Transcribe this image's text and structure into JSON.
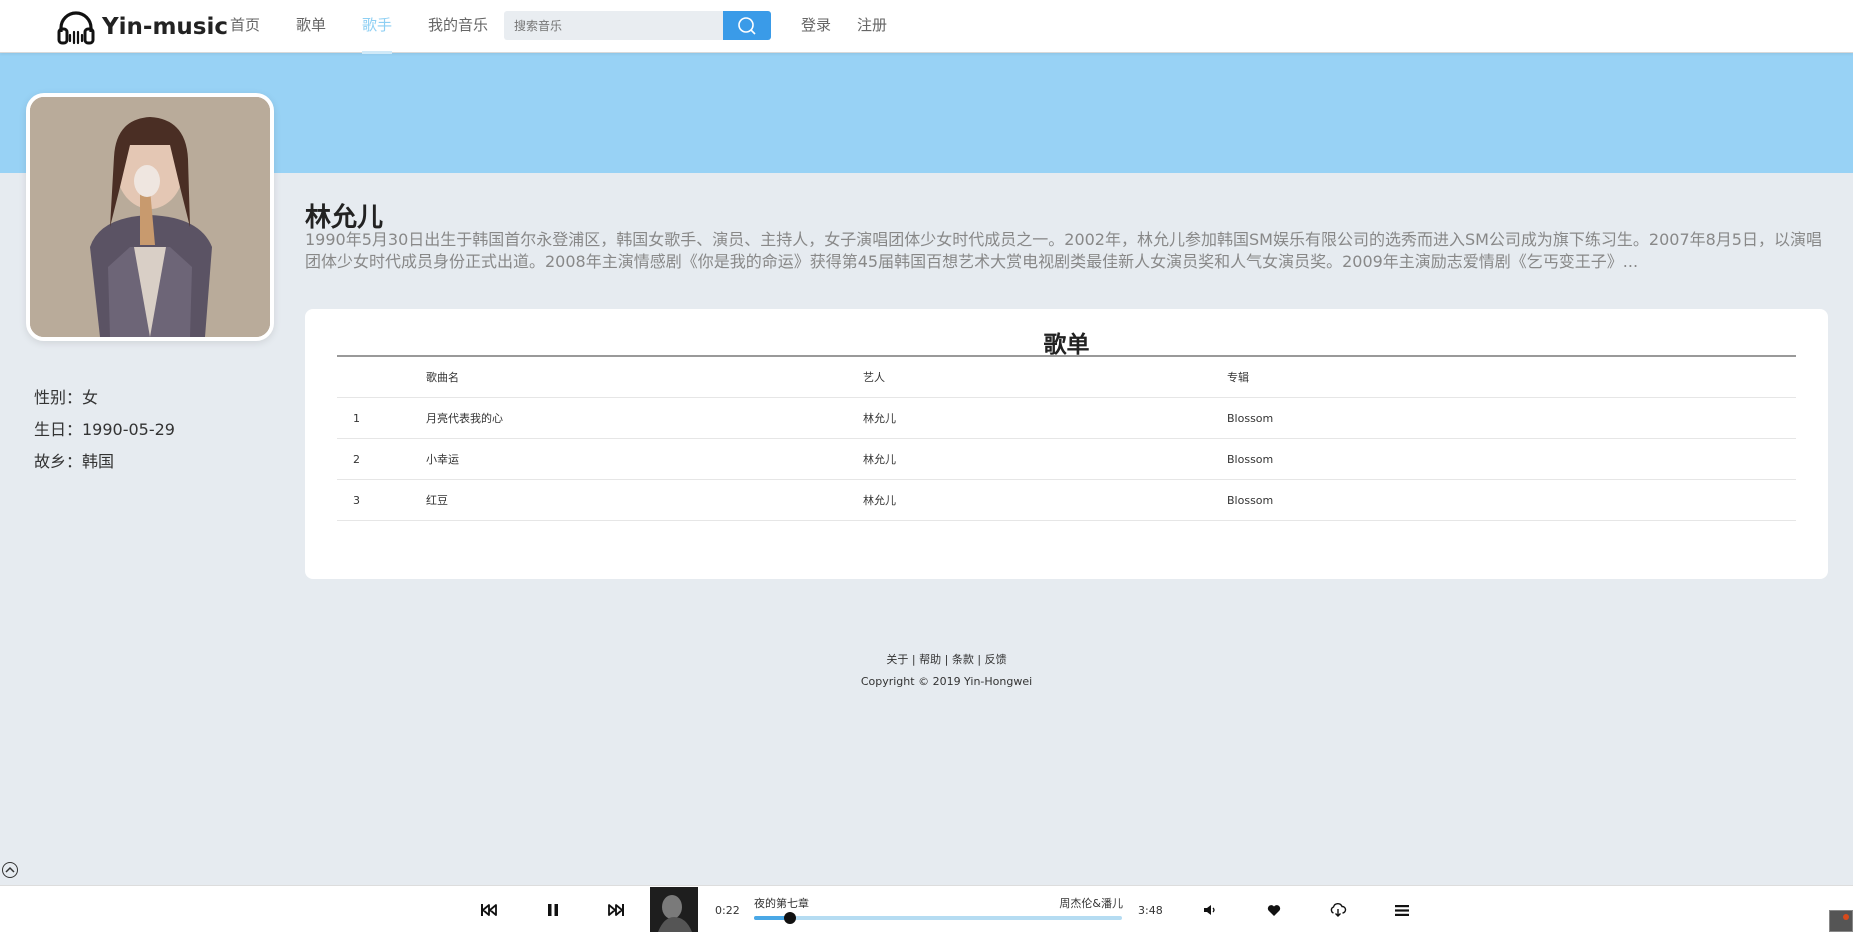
{
  "header": {
    "brand": "Yin-music",
    "nav": [
      {
        "label": "首页"
      },
      {
        "label": "歌单"
      },
      {
        "label": "歌手"
      },
      {
        "label": "我的音乐"
      }
    ],
    "active_nav": "歌手",
    "search_placeholder": "搜索音乐",
    "login": "登录",
    "register": "注册",
    "accent_color": "#3a9be8"
  },
  "singer": {
    "name": "林允儿",
    "description": "1990年5月30日出生于韩国首尔永登浦区，韩国女歌手、演员、主持人，女子演唱团体少女时代成员之一。2002年，林允儿参加韩国SM娱乐有限公司的选秀而进入SM公司成为旗下练习生。2007年8月5日，以演唱团体少女时代成员身份正式出道。2008年主演情感剧《你是我的命运》获得第45届韩国百想艺术大赏电视剧类最佳新人女演员奖和人气女演员奖。2009年主演励志爱情剧《乞丐变王子》...",
    "gender": "性别：女",
    "birthday": "生日：1990-05-29",
    "hometown": "故乡：韩国"
  },
  "songlist": {
    "title": "歌单",
    "columns": {
      "index": "",
      "name": "歌曲名",
      "artist": "艺人",
      "album": "专辑"
    },
    "rows": [
      {
        "index": "1",
        "name": "月亮代表我的心",
        "artist": "林允儿",
        "album": "Blossom"
      },
      {
        "index": "2",
        "name": "小幸运",
        "artist": "林允儿",
        "album": "Blossom"
      },
      {
        "index": "3",
        "name": "红豆",
        "artist": "林允儿",
        "album": "Blossom"
      }
    ]
  },
  "footer": {
    "links": [
      "关于",
      "帮助",
      "条款",
      "反馈"
    ],
    "separator": "|",
    "copyright": "Copyright © 2019 Yin-Hongwei"
  },
  "player": {
    "current_time": "0:22",
    "total_time": "3:48",
    "song_title": "夜的第七章",
    "song_artist": "周杰伦&潘儿",
    "progress_fraction": 0.097,
    "progress_color": "#4aa8e6"
  }
}
